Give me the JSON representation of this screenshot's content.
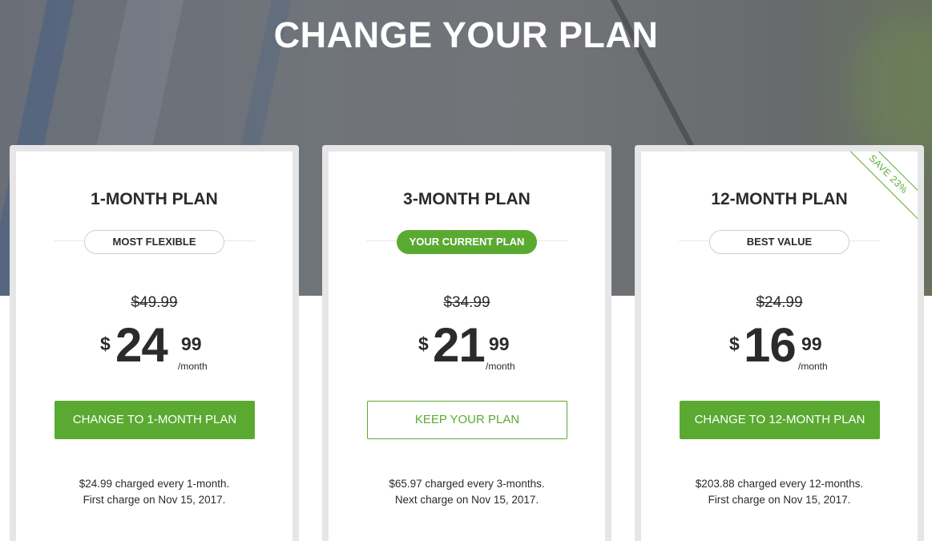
{
  "header": {
    "title": "CHANGE YOUR PLAN"
  },
  "colors": {
    "accent": "#5aaa32",
    "text": "#2b2b2b",
    "card_border": "#e6e6e6"
  },
  "plans": [
    {
      "name": "1-MONTH PLAN",
      "badge": "MOST FLEXIBLE",
      "old_price": "$49.99",
      "currency": "$",
      "price_whole": "24",
      "price_cents": "99",
      "per": "/month",
      "button": "CHANGE TO 1-MONTH PLAN",
      "note_line1": "$24.99 charged every 1-month.",
      "note_line2": "First charge on Nov 15, 2017."
    },
    {
      "name": "3-MONTH PLAN",
      "badge": "YOUR CURRENT PLAN",
      "old_price": "$34.99",
      "currency": "$",
      "price_whole": "21",
      "price_cents": "99",
      "per": "/month",
      "button": "KEEP YOUR PLAN",
      "note_line1": "$65.97 charged every 3-months.",
      "note_line2": "Next charge on Nov 15, 2017."
    },
    {
      "name": "12-MONTH PLAN",
      "badge": "BEST VALUE",
      "ribbon": "SAVE 23%",
      "old_price": "$24.99",
      "currency": "$",
      "price_whole": "16",
      "price_cents": "99",
      "per": "/month",
      "button": "CHANGE TO 12-MONTH PLAN",
      "note_line1": "$203.88 charged every 12-months.",
      "note_line2": "First charge on Nov 15, 2017."
    }
  ]
}
